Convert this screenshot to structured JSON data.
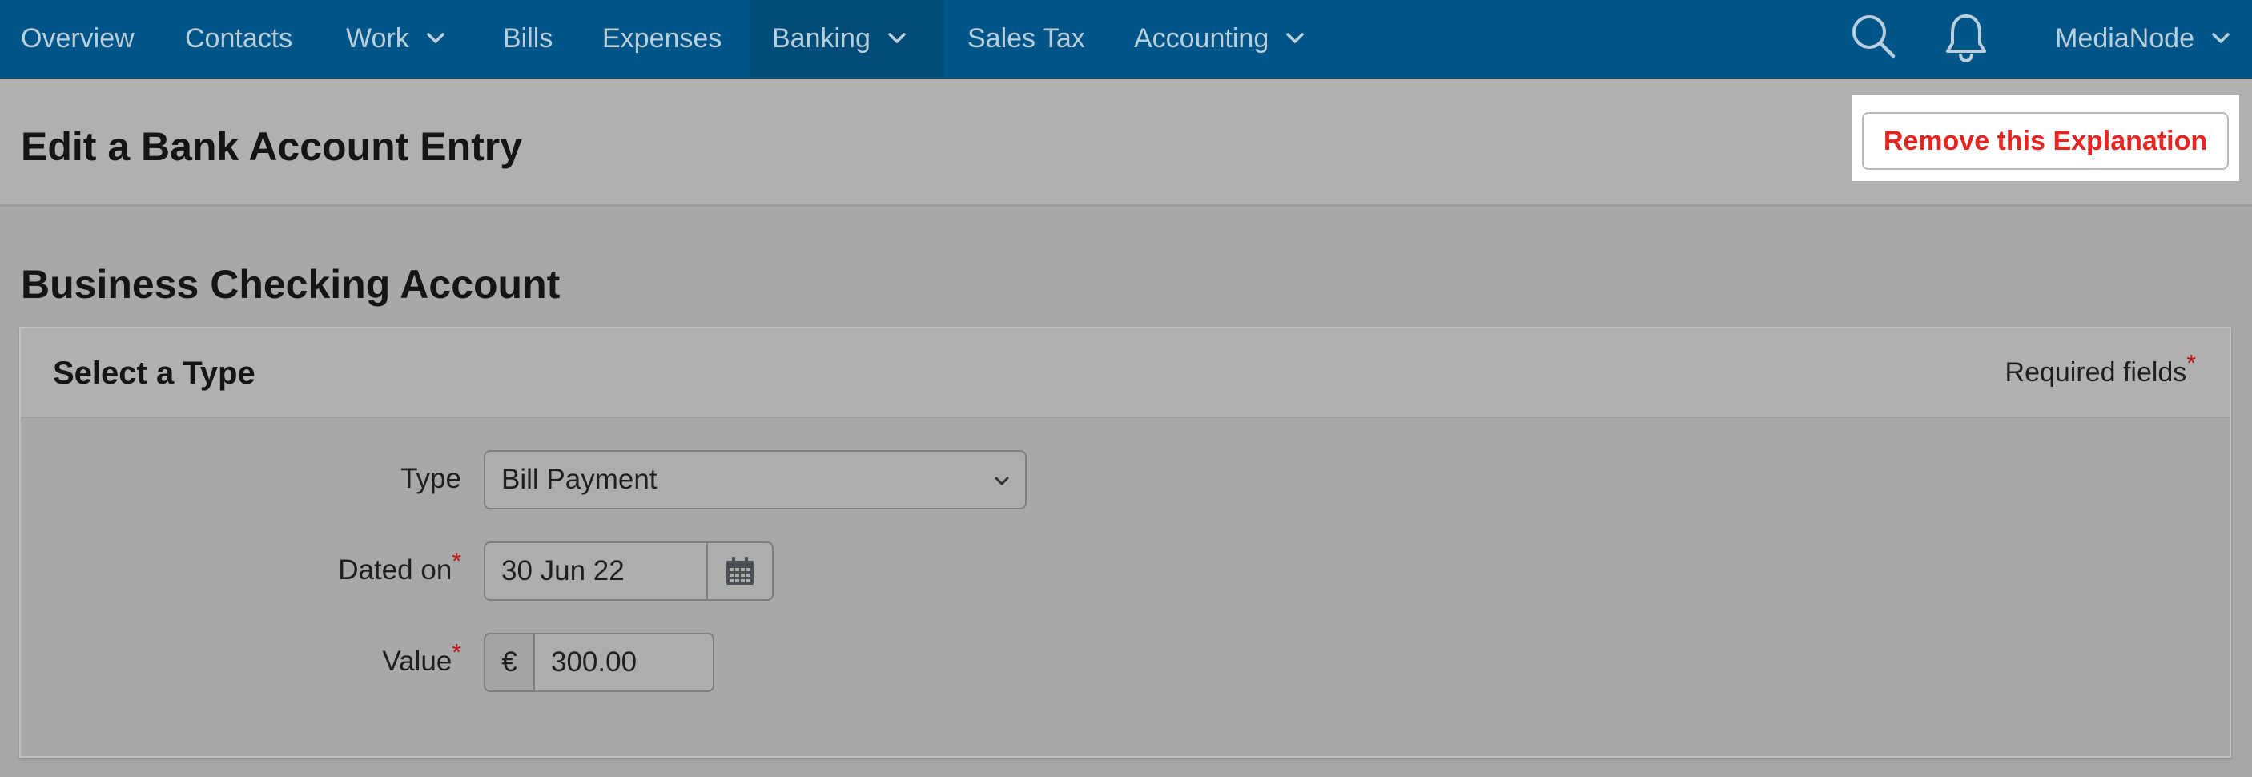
{
  "nav": {
    "items": [
      {
        "label": "Overview",
        "dropdown": false
      },
      {
        "label": "Contacts",
        "dropdown": false
      },
      {
        "label": "Work",
        "dropdown": true
      },
      {
        "label": "Bills",
        "dropdown": false
      },
      {
        "label": "Expenses",
        "dropdown": false
      },
      {
        "label": "Banking",
        "dropdown": true,
        "active": true
      },
      {
        "label": "Sales Tax",
        "dropdown": false
      },
      {
        "label": "Accounting",
        "dropdown": true
      }
    ],
    "user": "MediaNode",
    "icons": [
      "search-icon",
      "bell-icon",
      "chevron-down-icon"
    ]
  },
  "header": {
    "title": "Edit a Bank Account Entry",
    "remove_button": "Remove this Explanation"
  },
  "account": {
    "title": "Business Checking Account"
  },
  "panel": {
    "title": "Select a Type",
    "required_note": "Required fields",
    "required_star": "*",
    "fields": {
      "type_label": "Type",
      "type_value": "Bill Payment",
      "dated_label": "Dated on",
      "dated_value": "30 Jun 22",
      "value_label": "Value",
      "currency": "€",
      "value_amount": "300.00"
    }
  },
  "colors": {
    "nav_bg": "#005588",
    "remove_text": "#e52520",
    "required_star": "#c30f12"
  }
}
